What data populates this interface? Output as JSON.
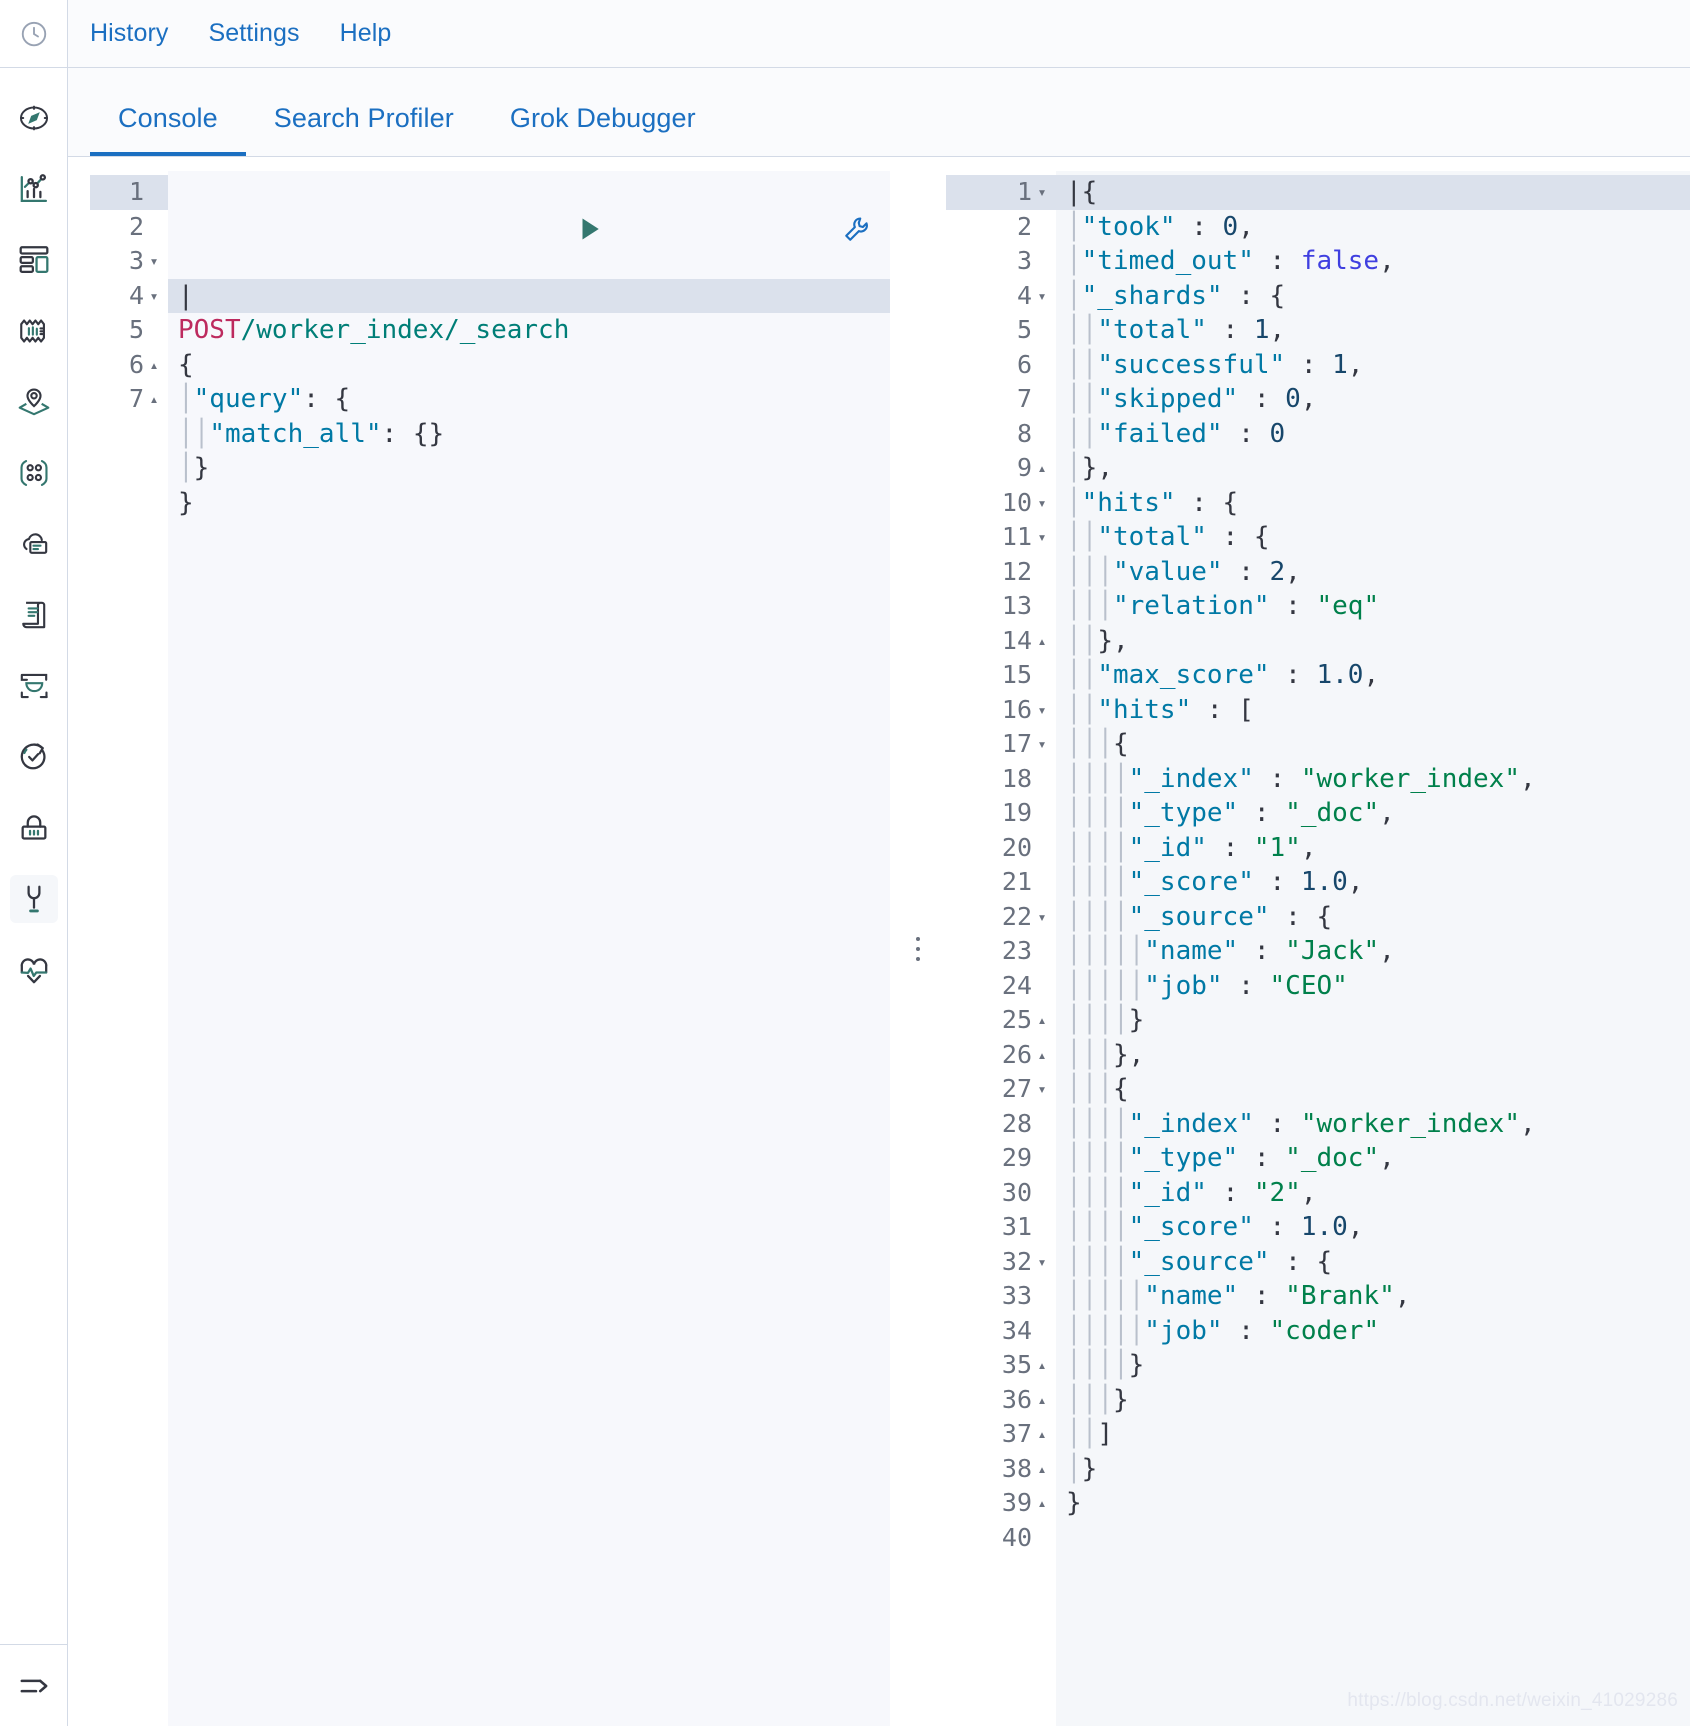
{
  "app": {
    "watermark": "https://blog.csdn.net/weixin_41029286"
  },
  "nav_rail": {
    "logo_icon": "clock-icon",
    "items": [
      {
        "icon": "compass-icon",
        "name": "discover",
        "selected": false
      },
      {
        "icon": "bar-chart-icon",
        "name": "visualize",
        "selected": false
      },
      {
        "icon": "dashboard-icon",
        "name": "dashboard",
        "selected": false
      },
      {
        "icon": "canvas-icon",
        "name": "canvas",
        "selected": false
      },
      {
        "icon": "maps-icon",
        "name": "maps",
        "selected": false
      },
      {
        "icon": "graph-icon",
        "name": "graph",
        "selected": false
      },
      {
        "icon": "machine-learning-icon",
        "name": "machine-learning",
        "selected": false
      },
      {
        "icon": "logs-icon",
        "name": "logs",
        "selected": false
      },
      {
        "icon": "infrastructure-icon",
        "name": "infrastructure",
        "selected": false
      },
      {
        "icon": "uptime-icon",
        "name": "uptime",
        "selected": false
      },
      {
        "icon": "siem-icon",
        "name": "siem",
        "selected": false
      },
      {
        "icon": "dev-tools-icon",
        "name": "dev-tools",
        "selected": true
      },
      {
        "icon": "monitoring-icon",
        "name": "monitoring",
        "selected": false
      }
    ],
    "bottom": {
      "icon": "collapse-arrow-icon",
      "name": "collapse-nav"
    }
  },
  "topbar": {
    "links": [
      {
        "label": "History"
      },
      {
        "label": "Settings"
      },
      {
        "label": "Help"
      }
    ]
  },
  "tabs": [
    {
      "label": "Console",
      "active": true
    },
    {
      "label": "Search Profiler",
      "active": false
    },
    {
      "label": "Grok Debugger",
      "active": false
    }
  ],
  "editor_actions": {
    "run": {
      "name": "send-request-button",
      "title": "Click to send request"
    },
    "wrench": {
      "name": "request-options-button",
      "title": "Open documentation"
    }
  },
  "request_editor": {
    "active_line": 1,
    "lines": [
      {
        "n": 1,
        "fold": "",
        "text": ""
      },
      {
        "n": 2,
        "fold": "",
        "text": "POST /worker_index/_search"
      },
      {
        "n": 3,
        "fold": "▾",
        "text": "{"
      },
      {
        "n": 4,
        "fold": "▾",
        "text": "  \"query\": {"
      },
      {
        "n": 5,
        "fold": "",
        "text": "    \"match_all\": {}"
      },
      {
        "n": 6,
        "fold": "▴",
        "text": "  }"
      },
      {
        "n": 7,
        "fold": "▴",
        "text": "}"
      }
    ]
  },
  "response_editor": {
    "active_line": 1,
    "lines": [
      {
        "n": 1,
        "fold": "▾",
        "text": "{"
      },
      {
        "n": 2,
        "fold": "",
        "text": "  \"took\" : 0,"
      },
      {
        "n": 3,
        "fold": "",
        "text": "  \"timed_out\" : false,"
      },
      {
        "n": 4,
        "fold": "▾",
        "text": "  \"_shards\" : {"
      },
      {
        "n": 5,
        "fold": "",
        "text": "    \"total\" : 1,"
      },
      {
        "n": 6,
        "fold": "",
        "text": "    \"successful\" : 1,"
      },
      {
        "n": 7,
        "fold": "",
        "text": "    \"skipped\" : 0,"
      },
      {
        "n": 8,
        "fold": "",
        "text": "    \"failed\" : 0"
      },
      {
        "n": 9,
        "fold": "▴",
        "text": "  },"
      },
      {
        "n": 10,
        "fold": "▾",
        "text": "  \"hits\" : {"
      },
      {
        "n": 11,
        "fold": "▾",
        "text": "    \"total\" : {"
      },
      {
        "n": 12,
        "fold": "",
        "text": "      \"value\" : 2,"
      },
      {
        "n": 13,
        "fold": "",
        "text": "      \"relation\" : \"eq\""
      },
      {
        "n": 14,
        "fold": "▴",
        "text": "    },"
      },
      {
        "n": 15,
        "fold": "",
        "text": "    \"max_score\" : 1.0,"
      },
      {
        "n": 16,
        "fold": "▾",
        "text": "    \"hits\" : ["
      },
      {
        "n": 17,
        "fold": "▾",
        "text": "      {"
      },
      {
        "n": 18,
        "fold": "",
        "text": "        \"_index\" : \"worker_index\","
      },
      {
        "n": 19,
        "fold": "",
        "text": "        \"_type\" : \"_doc\","
      },
      {
        "n": 20,
        "fold": "",
        "text": "        \"_id\" : \"1\","
      },
      {
        "n": 21,
        "fold": "",
        "text": "        \"_score\" : 1.0,"
      },
      {
        "n": 22,
        "fold": "▾",
        "text": "        \"_source\" : {"
      },
      {
        "n": 23,
        "fold": "",
        "text": "          \"name\" : \"Jack\","
      },
      {
        "n": 24,
        "fold": "",
        "text": "          \"job\" : \"CEO\""
      },
      {
        "n": 25,
        "fold": "▴",
        "text": "        }"
      },
      {
        "n": 26,
        "fold": "▴",
        "text": "      },"
      },
      {
        "n": 27,
        "fold": "▾",
        "text": "      {"
      },
      {
        "n": 28,
        "fold": "",
        "text": "        \"_index\" : \"worker_index\","
      },
      {
        "n": 29,
        "fold": "",
        "text": "        \"_type\" : \"_doc\","
      },
      {
        "n": 30,
        "fold": "",
        "text": "        \"_id\" : \"2\","
      },
      {
        "n": 31,
        "fold": "",
        "text": "        \"_score\" : 1.0,"
      },
      {
        "n": 32,
        "fold": "▾",
        "text": "        \"_source\" : {"
      },
      {
        "n": 33,
        "fold": "",
        "text": "          \"name\" : \"Brank\","
      },
      {
        "n": 34,
        "fold": "",
        "text": "          \"job\" : \"coder\""
      },
      {
        "n": 35,
        "fold": "▴",
        "text": "        }"
      },
      {
        "n": 36,
        "fold": "▴",
        "text": "      }"
      },
      {
        "n": 37,
        "fold": "▴",
        "text": "    ]"
      },
      {
        "n": 38,
        "fold": "▴",
        "text": "  }"
      },
      {
        "n": 39,
        "fold": "▴",
        "text": "}"
      },
      {
        "n": 40,
        "fold": "",
        "text": ""
      }
    ]
  },
  "colors": {
    "accent": "#1b6fc1",
    "elastic_teal": "#34776f",
    "method": "#bd2a5e",
    "url": "#007e77",
    "key": "#0079a5",
    "string": "#00804b",
    "number": "#17476b",
    "boolean": "#3f3fe0",
    "active_line_bg": "#dbe1ec",
    "response_bg": "#f5f7fa"
  }
}
